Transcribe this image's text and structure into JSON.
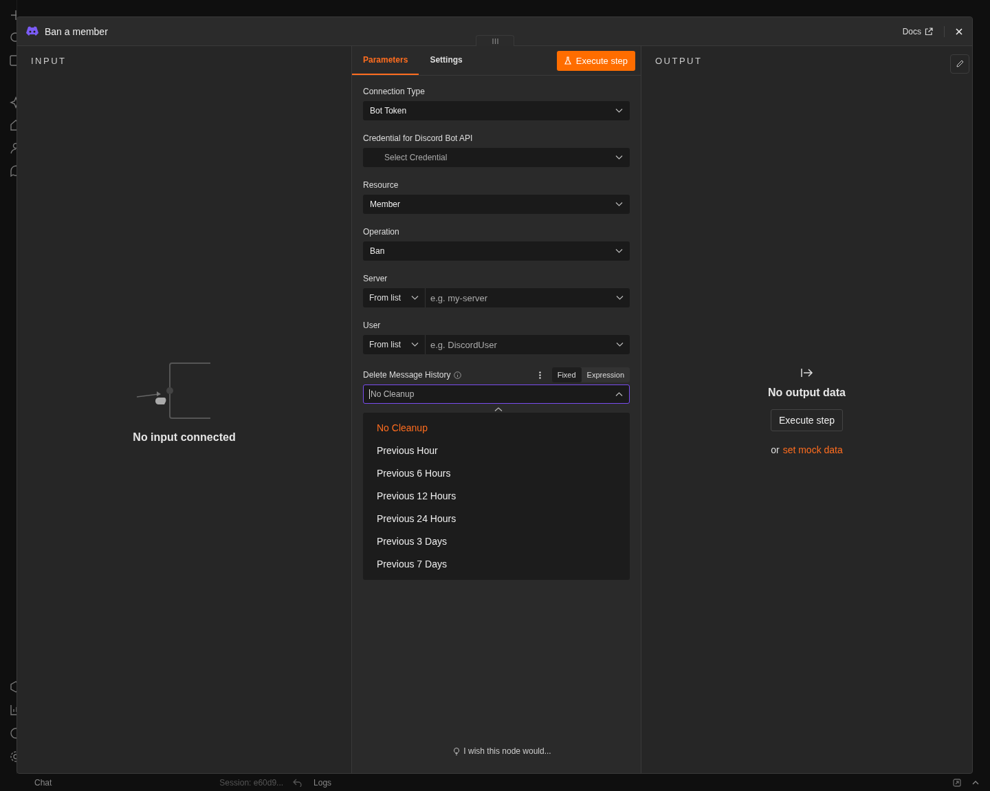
{
  "window": {
    "title": "Ban a member",
    "docs_link": "Docs"
  },
  "input_panel": {
    "heading": "INPUT",
    "empty_message": "No input connected"
  },
  "node_tabs": [
    {
      "label": "Parameters",
      "selected": true
    },
    {
      "label": "Settings",
      "selected": false
    }
  ],
  "execute_button": "Execute step",
  "parameters": [
    {
      "kind": "select",
      "label": "Connection Type",
      "value": "Bot Token"
    },
    {
      "kind": "credential",
      "label": "Credential for Discord Bot API",
      "placeholder": "Select Credential"
    },
    {
      "kind": "select",
      "label": "Resource",
      "value": "Member"
    },
    {
      "kind": "select",
      "label": "Operation",
      "value": "Ban"
    },
    {
      "kind": "locator",
      "label": "Server",
      "mode": "From list",
      "placeholder": "e.g. my-server"
    },
    {
      "kind": "locator",
      "label": "User",
      "mode": "From list",
      "placeholder": "e.g. DiscordUser"
    }
  ],
  "message_history": {
    "label": "Delete Message History",
    "mode_toggle": [
      {
        "label": "Fixed",
        "selected": true
      },
      {
        "label": "Expression",
        "selected": false
      }
    ],
    "value": "No Cleanup",
    "expanded": true,
    "options": [
      {
        "label": "No Cleanup",
        "selected": true
      },
      {
        "label": "Previous Hour",
        "selected": false
      },
      {
        "label": "Previous 6 Hours",
        "selected": false
      },
      {
        "label": "Previous 12 Hours",
        "selected": false
      },
      {
        "label": "Previous 24 Hours",
        "selected": false
      },
      {
        "label": "Previous 3 Days",
        "selected": false
      },
      {
        "label": "Previous 7 Days",
        "selected": false
      }
    ]
  },
  "feedback_link": "I wish this node would...",
  "output_panel": {
    "heading": "OUTPUT",
    "empty_title": "No output data",
    "execute_button": "Execute step",
    "mock_prefix": "or",
    "mock_link": "set mock data"
  },
  "bottom_bar": {
    "chat": "Chat",
    "session": "Session: e60d9...",
    "logs": "Logs"
  }
}
